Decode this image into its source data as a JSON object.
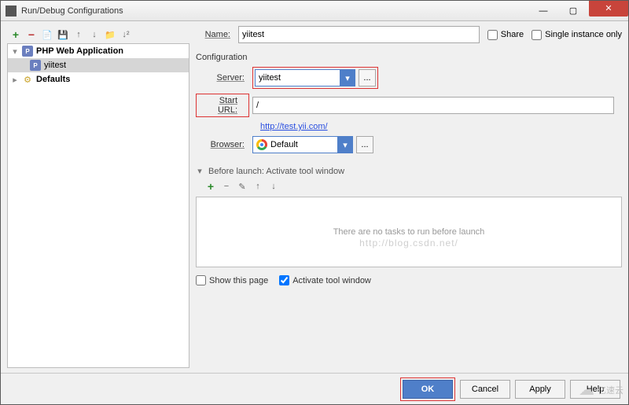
{
  "window": {
    "title": "Run/Debug Configurations"
  },
  "topchecks": {
    "share": "Share",
    "single": "Single instance only"
  },
  "tree": {
    "app_group": "PHP Web Application",
    "item1": "yiitest",
    "defaults": "Defaults"
  },
  "form": {
    "name_label": "Name:",
    "name_value": "yiitest",
    "config_title": "Configuration",
    "server_label": "Server:",
    "server_value": "yiitest",
    "dots": "...",
    "starturl_label": "Start URL:",
    "starturl_value": "/",
    "starturl_link": "http://test.yii.com/",
    "browser_label": "Browser:",
    "browser_value": "Default"
  },
  "before": {
    "title": "Before launch: Activate tool window",
    "empty": "There are no tasks to run before launch",
    "watermark": "http://blog.csdn.net/"
  },
  "opts": {
    "show_page": "Show this page",
    "activate": "Activate tool window"
  },
  "footer": {
    "ok": "OK",
    "cancel": "Cancel",
    "apply": "Apply",
    "help": "Help"
  },
  "brand": "亿速云"
}
